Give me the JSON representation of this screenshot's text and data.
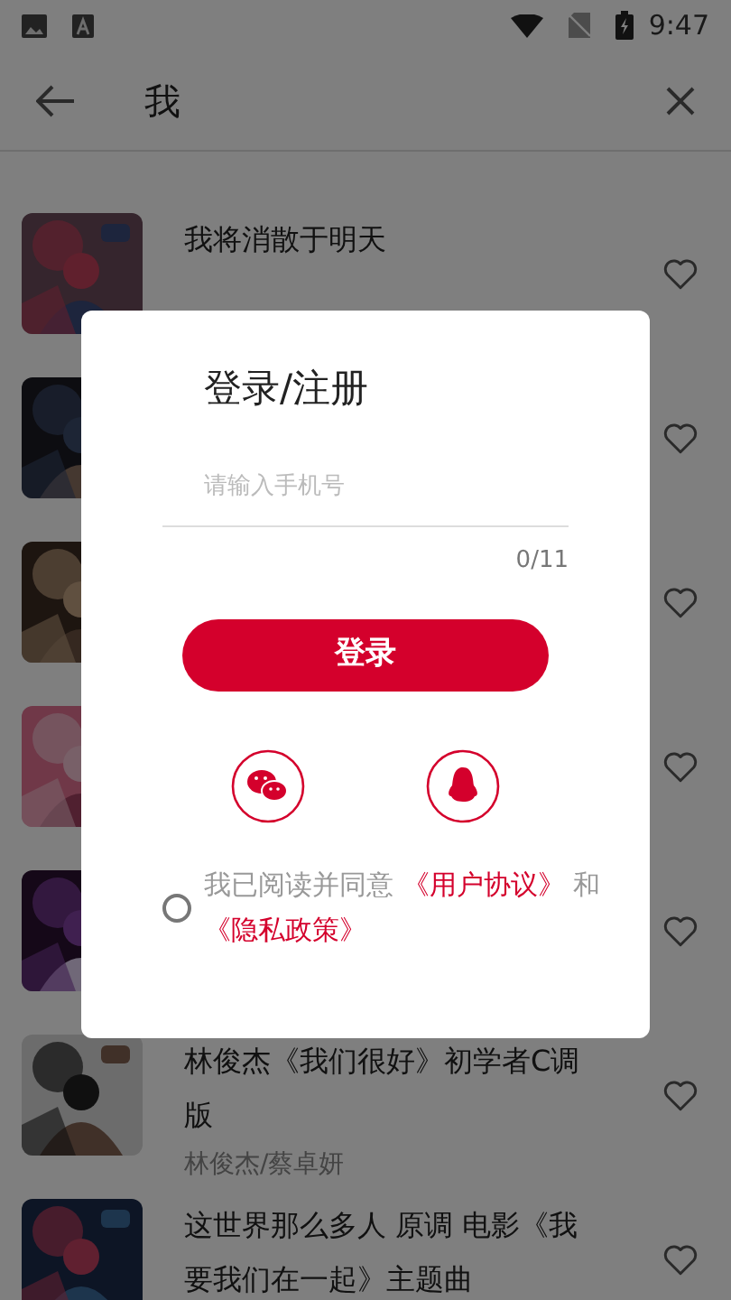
{
  "status_bar": {
    "time": "9:47"
  },
  "search": {
    "value": "我"
  },
  "songs": [
    {
      "title": "我将消散于明天",
      "cover": {
        "kind": "picture"
      }
    },
    {
      "cover": {
        "kind": "picture"
      }
    },
    {
      "cover": {
        "kind": "picture"
      }
    },
    {
      "cover": {
        "kind": "picture"
      }
    },
    {
      "cover": {
        "kind": "picture"
      }
    },
    {
      "title": "林俊杰《我们很好》初学者C调版",
      "artist": "林俊杰/蔡卓妍",
      "cover": {
        "kind": "picture"
      }
    },
    {
      "title": "这世界那么多人 原调 电影《我要我们在一起》主题曲",
      "cover": {
        "kind": "picture"
      }
    }
  ],
  "dialog": {
    "title": "登录/注册",
    "phone_placeholder": "请输入手机号",
    "counter": "0/11",
    "login_button": "登录",
    "agreement": {
      "agreed": false,
      "prefix": "我已阅读并同意",
      "link1": "《用户协议》",
      "middle": "和",
      "link2": "《隐私政策》"
    }
  }
}
